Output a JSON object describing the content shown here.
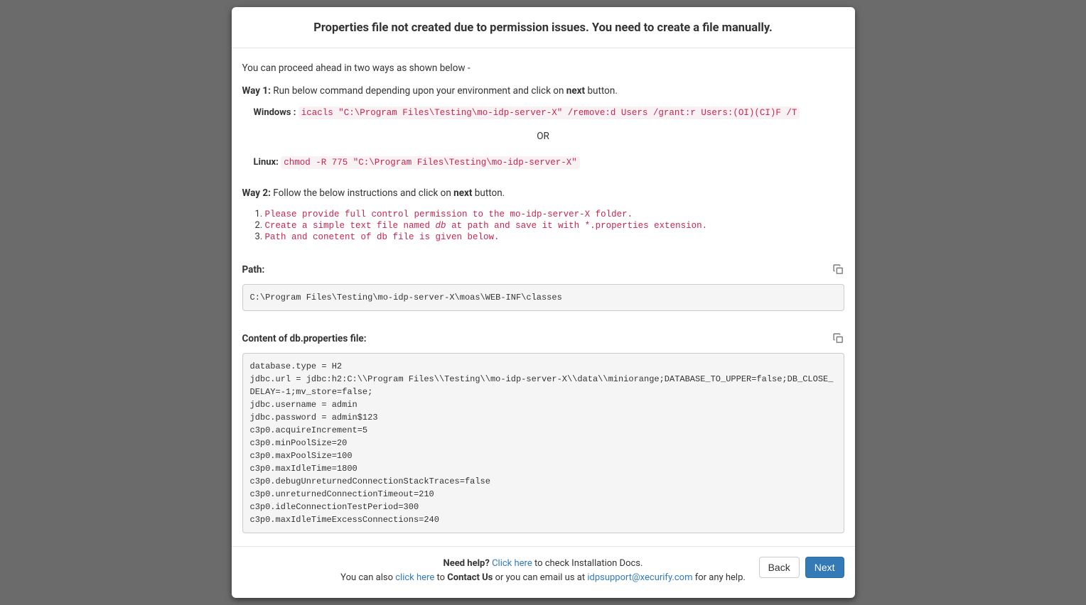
{
  "header": {
    "title": "Properties file not created due to permission issues. You need to create a file manually."
  },
  "body": {
    "intro": "You can proceed ahead in two ways as shown below -",
    "way1_label": "Way 1:",
    "way1_text_a": " Run below command depending upon your environment and click on ",
    "way1_next": "next",
    "way1_text_b": " button.",
    "windows_label": "Windows :",
    "windows_cmd": "icacls \"C:\\Program Files\\Testing\\mo-idp-server-X\" /remove:d Users /grant:r Users:(OI)(CI)F /T",
    "or_text": "OR",
    "linux_label": "Linux:",
    "linux_cmd": "chmod -R 775 \"C:\\Program Files\\Testing\\mo-idp-server-X\"",
    "way2_label": "Way 2:",
    "way2_text_a": " Follow the below instructions and click on ",
    "way2_next": "next",
    "way2_text_b": " button.",
    "steps": {
      "s1": "Please provide full control permission to the mo-idp-server-X folder.",
      "s2_a": "Create a simple text file named ",
      "s2_db": "db",
      "s2_b": " at path and save it with *.properties extension.",
      "s3": "Path and conetent of db file is given below."
    },
    "path_label": "Path:",
    "path_value": "C:\\Program Files\\Testing\\mo-idp-server-X\\moas\\WEB-INF\\classes",
    "content_label": "Content of db.properties file:",
    "content_value": "database.type = H2\njdbc.url = jdbc:h2:C:\\\\Program Files\\\\Testing\\\\mo-idp-server-X\\\\data\\\\miniorange;DATABASE_TO_UPPER=false;DB_CLOSE_DELAY=-1;mv_store=false;\njdbc.username = admin\njdbc.password = admin$123\nc3p0.acquireIncrement=5\nc3p0.minPoolSize=20\nc3p0.maxPoolSize=100\nc3p0.maxIdleTime=1800\nc3p0.debugUnreturnedConnectionStackTraces=false\nc3p0.unreturnedConnectionTimeout=210\nc3p0.idleConnectionTestPeriod=300\nc3p0.maxIdleTimeExcessConnections=240"
  },
  "footer": {
    "need_help": "Need help?",
    "click_here_1": "Click here",
    "install_docs": " to check Installation Docs.",
    "also_text_a": "You can also ",
    "click_here_2": "click here",
    "also_text_b": " to ",
    "contact_us": "Contact Us",
    "email_text_a": " or you can email us at ",
    "email_addr": "idpsupport@xecurify.com",
    "email_text_b": " for any help.",
    "back_label": "Back",
    "next_label": "Next"
  }
}
